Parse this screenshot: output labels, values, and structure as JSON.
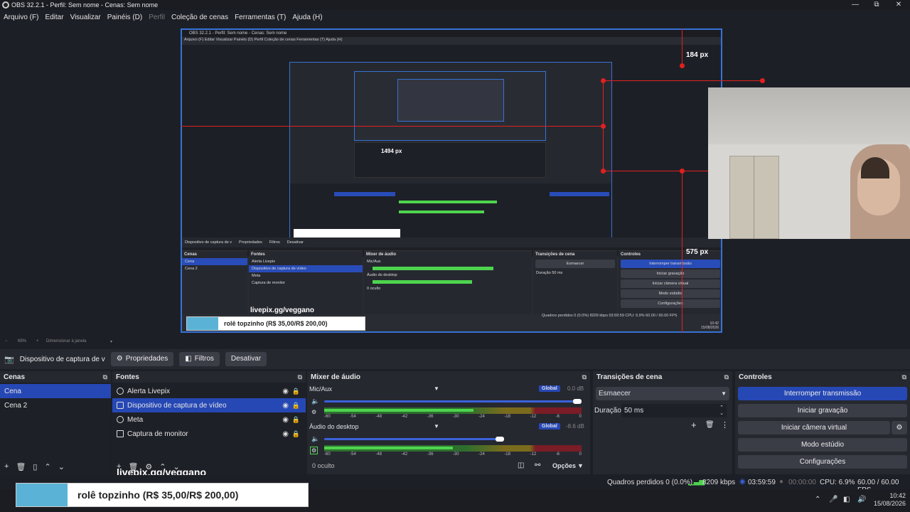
{
  "window": {
    "title": "OBS 32.2.1 - Perfil: Sem nome - Cenas: Sem nome",
    "minimize": "—",
    "restore": "⧉",
    "close": "✕"
  },
  "menu": [
    "Arquivo (F)",
    "Editar",
    "Visualizar",
    "Painéis (D)",
    "Perfil",
    "Coleção de cenas",
    "Ferramentas (T)",
    "Ajuda (H)"
  ],
  "nested": {
    "title": "OBS 32.2.1 - Perfil: Sem nome - Cenas: Sem nome",
    "menu": "Arquivo (F)   Editar   Visualizar   Painéis (D)   Perfil   Coleção de cenas   Ferramentas (T)   Ajuda (H)",
    "measure_top": "184 px",
    "measure_left": "1494 px",
    "measure_right": "575 px",
    "sourcebar": "Dispositivo de captura de v",
    "prop_buttons": [
      "Propriedades",
      "Filtros",
      "Desativar"
    ],
    "scenes_head": "Cenas",
    "scenes": [
      "Cena",
      "Cena 2"
    ],
    "sources_head": "Fontes",
    "sources": [
      "Alerta Livepix",
      "Dispositivo de captura de vídeo",
      "Meta",
      "Captura de monitor"
    ],
    "mixer_head": "Mixer de áudio",
    "mixer_ch1": "Mic/Aux",
    "mixer_ch2": "Áudio do desktop",
    "mixer_hidden": "0 oculto",
    "trans_head": "Transições de cena",
    "trans_value": "Esmaecer",
    "trans_dur_label": "Duração",
    "trans_dur": "50 ms",
    "ctrl_head": "Controles",
    "ctrl_buttons": [
      "Interromper transmissão",
      "Iniciar gravação",
      "Iniciar câmera virtual",
      "Modo estúdio",
      "Configurações"
    ],
    "status": "Quadros perdidos 0 (0.0%)   8209 kbps   03:59:59   CPU: 6.9%   60.00 / 60.00 FPS",
    "livepix": "livepix.gg/veggano",
    "overlay": "rolê topzinho (R$ 35,00/R$ 200,00)",
    "zoom": "69%",
    "zoom_mode": "Dimensionar à janela",
    "clock_time": "10:42",
    "clock_date": "15/08/2026"
  },
  "preview_bar": {
    "zoom": "69%",
    "mode": "Dimensionar à janela"
  },
  "source_toolbar": {
    "source": "Dispositivo de captura de v",
    "properties": "Propriedades",
    "filters": "Filtros",
    "deactivate": "Desativar"
  },
  "scenes": {
    "title": "Cenas",
    "items": [
      "Cena",
      "Cena 2"
    ],
    "selected": 0
  },
  "sources": {
    "title": "Fontes",
    "items": [
      "Alerta Livepix",
      "Dispositivo de captura de vídeo",
      "Meta",
      "Captura de monitor"
    ],
    "selected": 1
  },
  "mixer": {
    "title": "Mixer de áudio",
    "channels": [
      {
        "name": "Mic/Aux",
        "badge": "Global",
        "db": "0.0 dB",
        "volume": 1.0,
        "level": 0.58
      },
      {
        "name": "Áudio do desktop",
        "badge": "Global",
        "db": "-8.6 dB",
        "volume": 0.7,
        "level": 0.5
      }
    ],
    "ticks": [
      "-60",
      "-54",
      "-48",
      "-42",
      "-36",
      "-30",
      "-24",
      "-18",
      "-12",
      "-6",
      "0"
    ],
    "hidden": "0 oculto",
    "options": "Opções"
  },
  "transitions": {
    "title": "Transições de cena",
    "selected": "Esmaecer",
    "duration_label": "Duração",
    "duration": "50 ms"
  },
  "controls": {
    "title": "Controles",
    "buttons": [
      "Interromper transmissão",
      "Iniciar gravação",
      "Iniciar câmera virtual",
      "Modo estúdio",
      "Configurações"
    ]
  },
  "status": {
    "dropped": "Quadros perdidos 0 (0.0%)",
    "bitrate": "8209 kbps",
    "stream_time": "03:59:59",
    "rec_time": "00:00:00",
    "cpu": "CPU: 6.9%",
    "fps": "60.00 / 60.00 FPS"
  },
  "overlay": {
    "link": "livepix.gg/veggano",
    "goal": "rolê topzinho (R$ 35,00/R$ 200,00)"
  },
  "taskbar": {
    "time": "10:42",
    "date": "15/08/2026"
  },
  "colors": {
    "accent": "#2648b5",
    "border": "#3573d5",
    "guide": "#e02020",
    "meter_green": "#4ed44e",
    "overlay_bar": "#5ab3d6"
  },
  "icons": [
    "app-icon",
    "eye-icon",
    "lock-icon",
    "gear-icon",
    "add-icon",
    "remove-icon",
    "filter-icon",
    "up-icon",
    "down-icon",
    "menu-icon",
    "speaker-icon",
    "network-icon",
    "record-icon",
    "wifi-icon",
    "volume-icon"
  ]
}
